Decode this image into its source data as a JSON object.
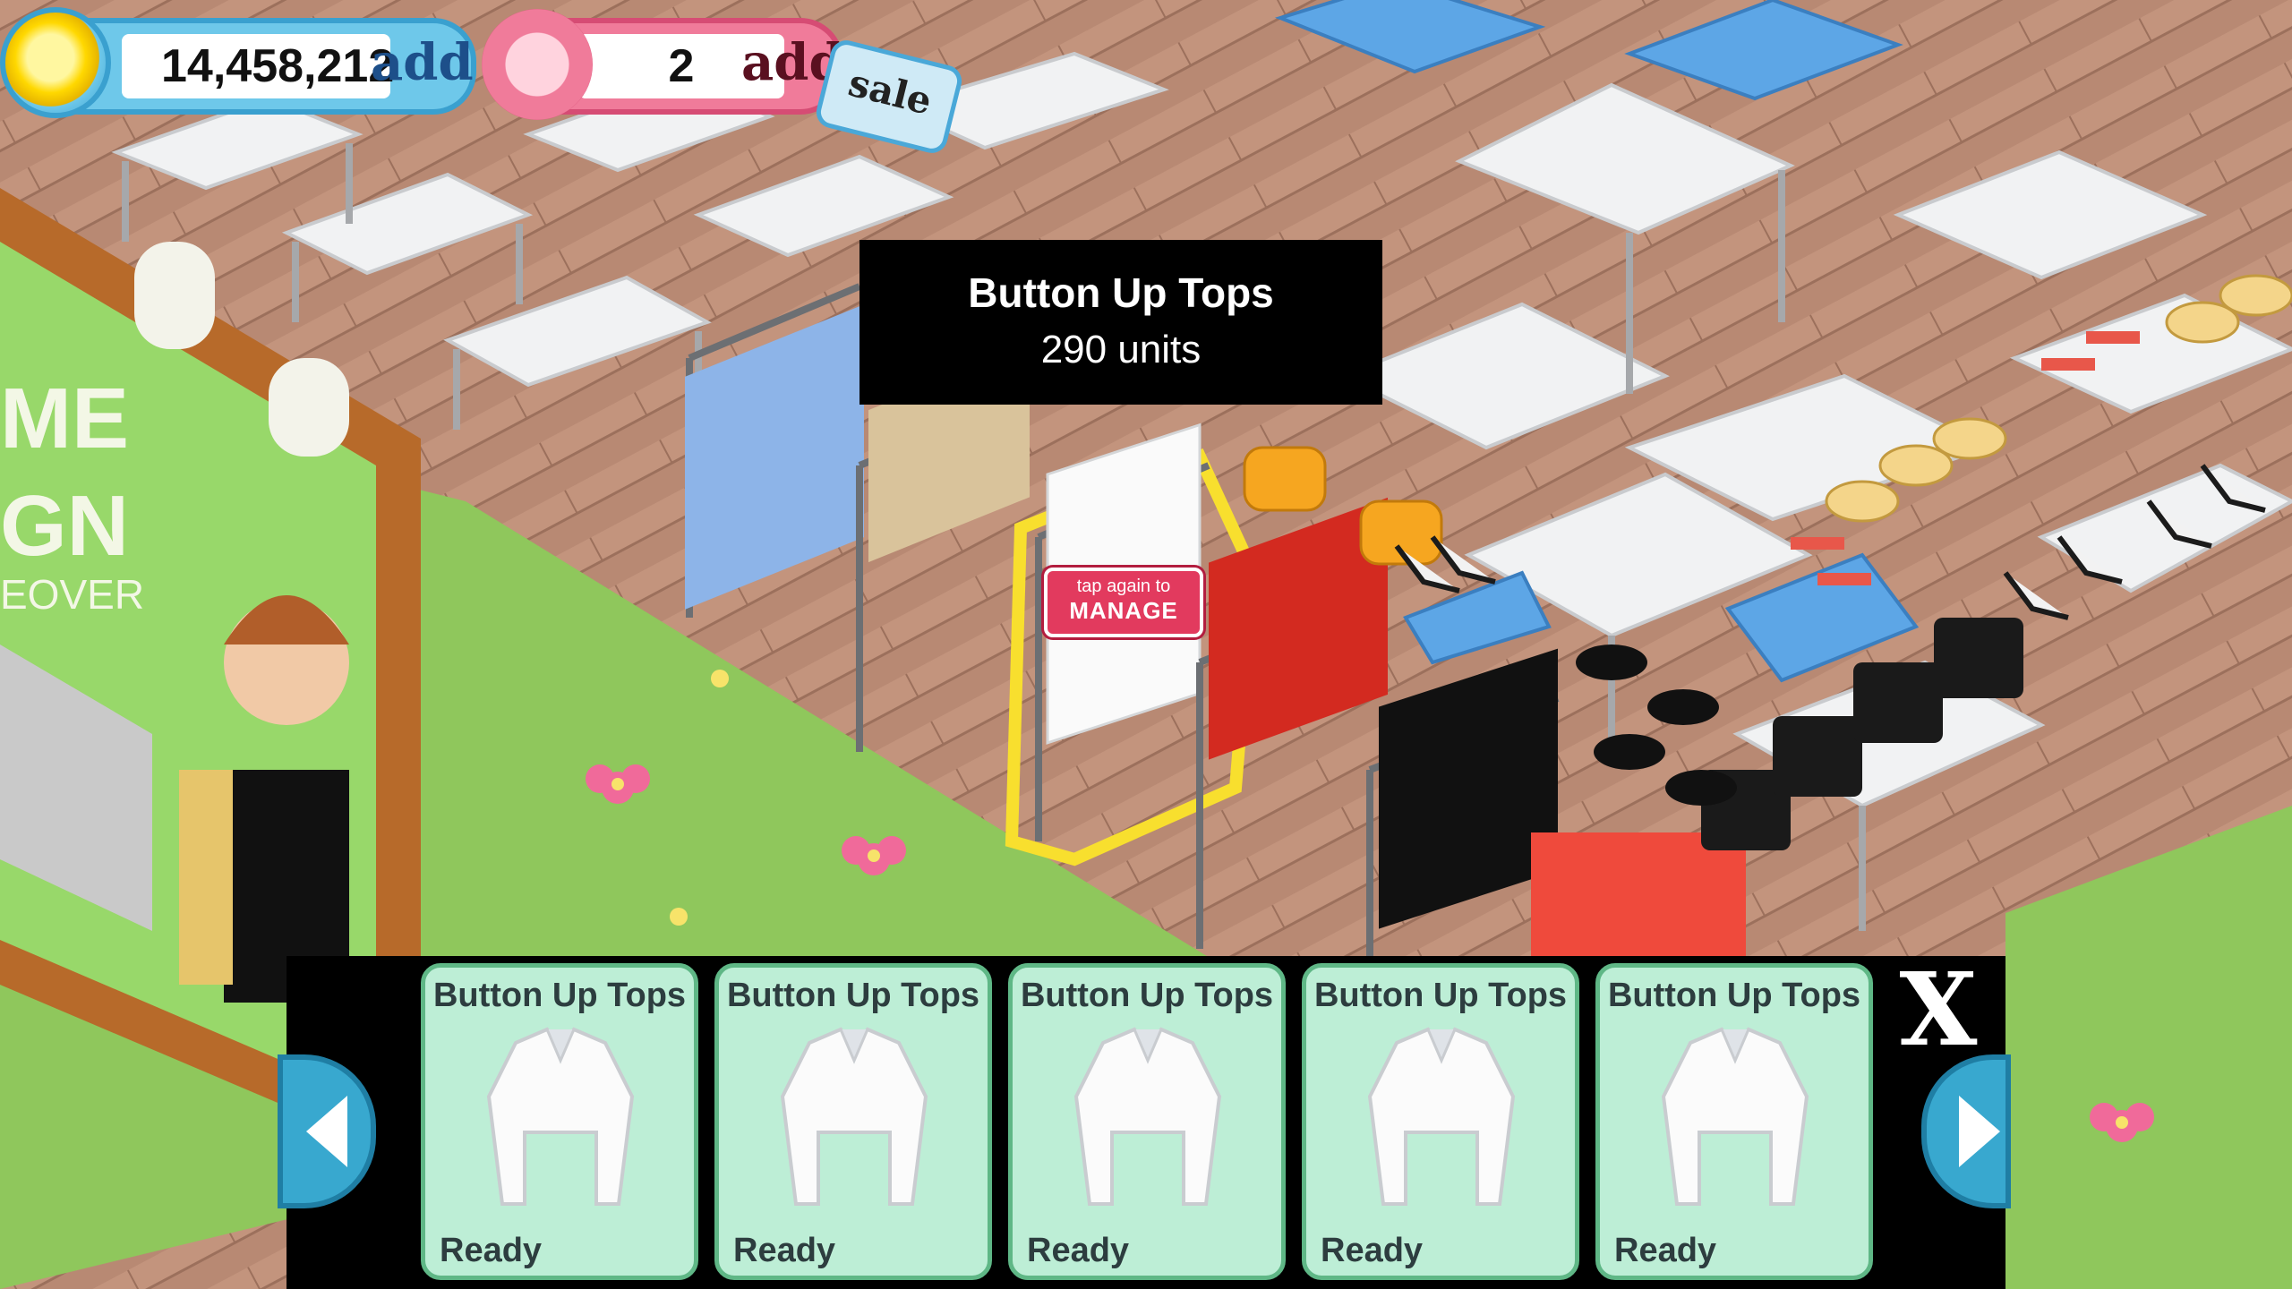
{
  "hud": {
    "coins": "14,458,212",
    "coins_add": "add",
    "gems": "2",
    "gems_add": "add",
    "sale": "sale"
  },
  "tooltip": {
    "title": "Button Up Tops",
    "subtitle": "290 units"
  },
  "manage_badge": {
    "line1": "tap again to",
    "line2": "MANAGE"
  },
  "billboard": {
    "partial_text": [
      "ME",
      "GN",
      "EOVER"
    ]
  },
  "bottom_bar": {
    "cards": [
      {
        "title": "Button Up Tops",
        "status": "Ready"
      },
      {
        "title": "Button Up Tops",
        "status": "Ready"
      },
      {
        "title": "Button Up Tops",
        "status": "Ready"
      },
      {
        "title": "Button Up Tops",
        "status": "Ready"
      },
      {
        "title": "Button Up Tops",
        "status": "Ready"
      }
    ],
    "close_label": "X"
  }
}
